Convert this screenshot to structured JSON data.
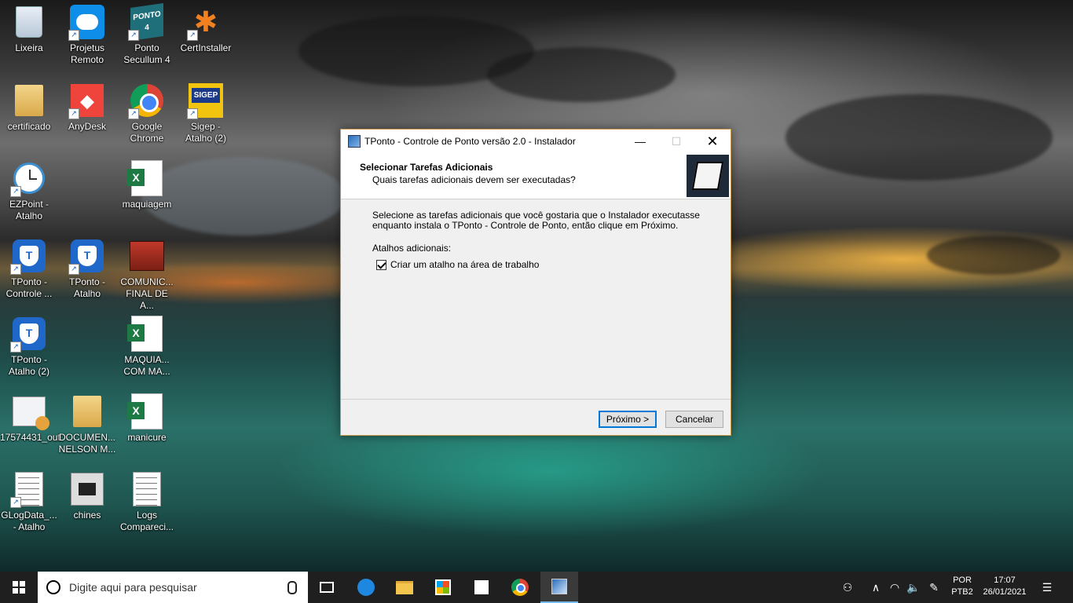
{
  "desktop": {
    "icons": [
      {
        "label": "Lixeira"
      },
      {
        "label": "Projetus Remoto"
      },
      {
        "label": "Ponto Secullum 4"
      },
      {
        "label": "CertInstaller"
      },
      {
        "label": "certificado"
      },
      {
        "label": "AnyDesk"
      },
      {
        "label": "Google Chrome"
      },
      {
        "label": "Sigep - Atalho (2)"
      },
      {
        "label": "EZPoint - Atalho"
      },
      {
        "label": "maquiagem"
      },
      {
        "label": "TPonto - Controle ..."
      },
      {
        "label": "TPonto - Atalho"
      },
      {
        "label": "COMUNIC... FINAL DE A..."
      },
      {
        "label": "TPonto - Atalho (2)"
      },
      {
        "label": "MAQUIA... COM MA..."
      },
      {
        "label": "17574431_out"
      },
      {
        "label": "DOCUMEN... NELSON M..."
      },
      {
        "label": "manicure"
      },
      {
        "label": "GLogData_... - Atalho"
      },
      {
        "label": "chines"
      },
      {
        "label": "Logs Compareci..."
      }
    ],
    "ponto_icon_text": "PONTO 4",
    "sigep_icon_text": "SIGEP"
  },
  "installer": {
    "window_title": "TPonto - Controle de Ponto versão 2.0 - Instalador",
    "header_title": "Selecionar Tarefas Adicionais",
    "header_subtitle": "Quais tarefas adicionais devem ser executadas?",
    "description": "Selecione as tarefas adicionais que você gostaria que o Instalador executasse enquanto instala o TPonto - Controle de Ponto, então clique em Próximo.",
    "group_label": "Atalhos adicionais:",
    "checkbox_label": "Criar um atalho na área de trabalho",
    "checkbox_checked": true,
    "next_button": "Próximo >",
    "cancel_button": "Cancelar",
    "minimize_glyph": "—",
    "maximize_glyph": "☐",
    "close_glyph": "✕"
  },
  "taskbar": {
    "search_placeholder": "Digite aqui para pesquisar",
    "apps": [
      "task-view-icon",
      "edge-icon",
      "file-explorer-icon",
      "store-icon",
      "sticky-notes-icon",
      "chrome-icon",
      "installer-icon"
    ],
    "tray": {
      "language_line1": "POR",
      "language_line2": "PTB2",
      "time": "17:07",
      "date": "26/01/2021"
    }
  }
}
